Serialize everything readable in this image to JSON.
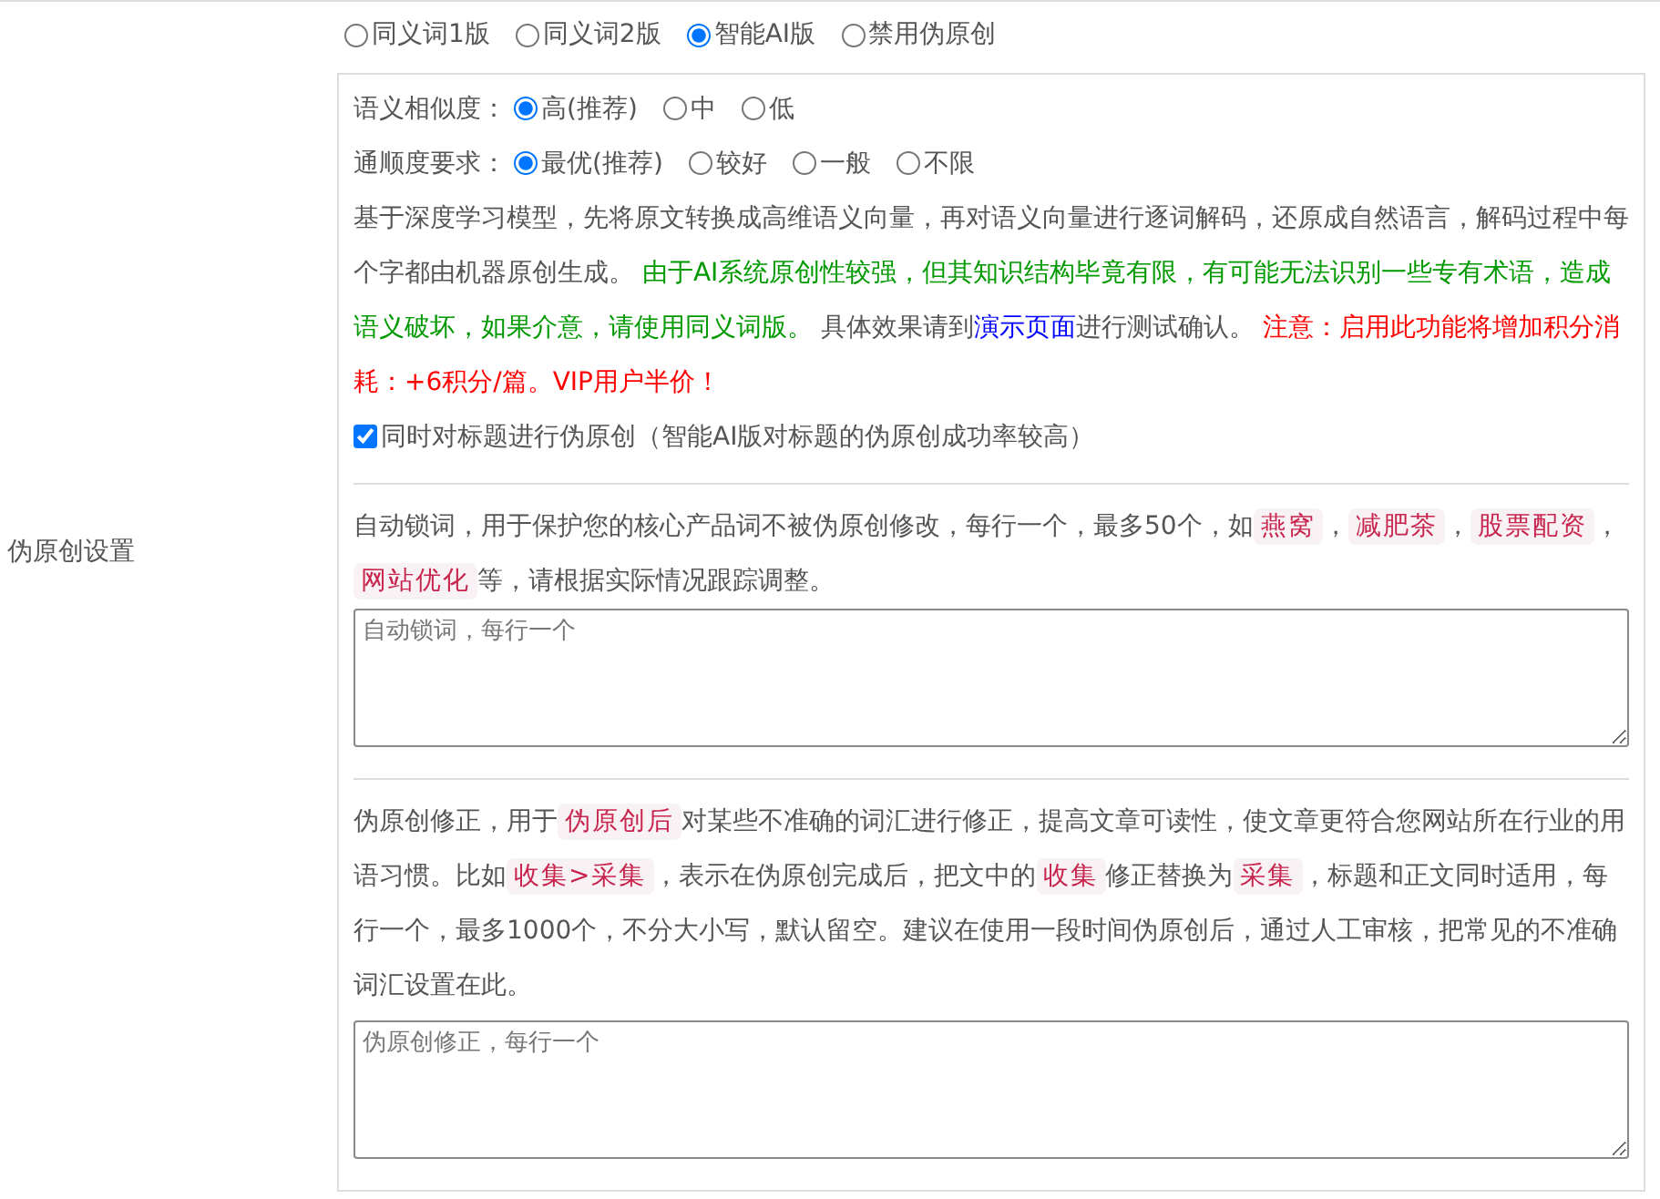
{
  "mode_options": [
    {
      "label": "同义词1版",
      "selected": false
    },
    {
      "label": "同义词2版",
      "selected": false
    },
    {
      "label": "智能AI版",
      "selected": true
    },
    {
      "label": "禁用伪原创",
      "selected": false
    }
  ],
  "ai_settings": {
    "rows": [
      {
        "label": "语义相似度：",
        "options": [
          {
            "label": "高(推荐)",
            "selected": true
          },
          {
            "label": "中",
            "selected": false
          },
          {
            "label": "低",
            "selected": false
          }
        ]
      },
      {
        "label": "通顺度要求：",
        "options": [
          {
            "label": "最优(推荐)",
            "selected": true
          },
          {
            "label": "较好",
            "selected": false
          },
          {
            "label": "一般",
            "selected": false
          },
          {
            "label": "不限",
            "selected": false
          }
        ]
      }
    ],
    "description": [
      {
        "kind": "plain",
        "text": "基于深度学习模型，先将原文转换成高维语义向量，再对语义向量进行逐词解码，还原成自然语言，解码过程中每个字都由机器原创生成。 "
      },
      {
        "kind": "green",
        "text": "由于AI系统原创性较强，但其知识结构毕竟有限，有可能无法识别一些专有术语，造成语义破坏，如果介意，请使用同义词版。"
      },
      {
        "kind": "plain",
        "text": " 具体效果请到"
      },
      {
        "kind": "link",
        "text": "演示页面"
      },
      {
        "kind": "plain",
        "text": "进行测试确认。 "
      },
      {
        "kind": "red",
        "text": "注意：启用此功能将增加积分消耗：+6积分/篇。VIP用户半价！"
      }
    ],
    "title_checkbox": {
      "label": "同时对标题进行伪原创（智能AI版对标题的伪原创成功率较高）",
      "checked": true
    }
  },
  "side_label": "伪原创设置",
  "lock_words": {
    "description": [
      {
        "kind": "plain",
        "text": "自动锁词，用于保护您的核心产品词不被伪原创修改，每行一个，最多50个，如"
      },
      {
        "kind": "code",
        "text": "燕窝"
      },
      {
        "kind": "plain",
        "text": "，"
      },
      {
        "kind": "code",
        "text": "减肥茶"
      },
      {
        "kind": "plain",
        "text": "，"
      },
      {
        "kind": "code",
        "text": "股票配资"
      },
      {
        "kind": "plain",
        "text": "，"
      },
      {
        "kind": "code",
        "text": "网站优化"
      },
      {
        "kind": "plain",
        "text": "等，请根据实际情况跟踪调整。"
      }
    ],
    "placeholder": "自动锁词，每行一个"
  },
  "corrections": {
    "description": [
      {
        "kind": "plain",
        "text": "伪原创修正，用于"
      },
      {
        "kind": "code",
        "text": "伪原创后"
      },
      {
        "kind": "plain",
        "text": "对某些不准确的词汇进行修正，提高文章可读性，使文章更符合您网站所在行业的用语习惯。比如"
      },
      {
        "kind": "code",
        "text": "收集>采集"
      },
      {
        "kind": "plain",
        "text": "，表示在伪原创完成后，把文中的"
      },
      {
        "kind": "code",
        "text": "收集"
      },
      {
        "kind": "plain",
        "text": "修正替换为"
      },
      {
        "kind": "code",
        "text": "采集"
      },
      {
        "kind": "plain",
        "text": "，标题和正文同时适用，每行一个，最多1000个，不分大小写，默认留空。建议在使用一段时间伪原创后，通过人工审核，把常见的不准确词汇设置在此。"
      }
    ],
    "placeholder": "伪原创修正，每行一个"
  }
}
